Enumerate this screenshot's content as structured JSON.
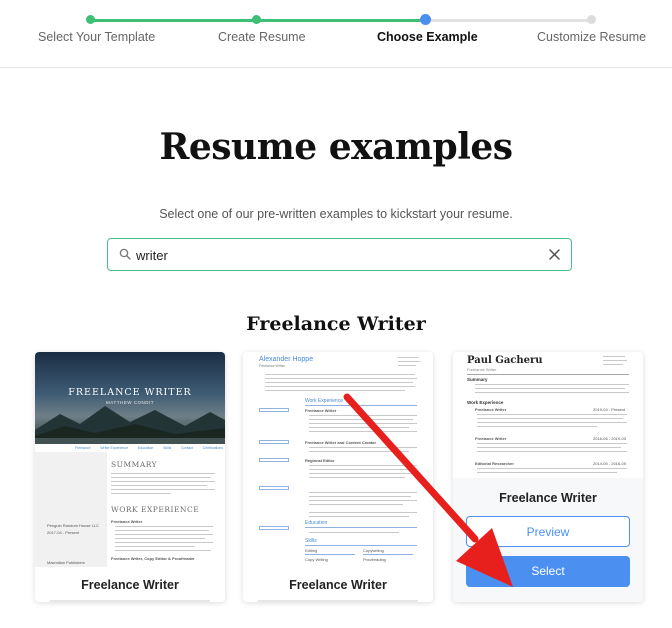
{
  "stepper": {
    "steps": [
      {
        "label": "Select Your Template",
        "state": "done"
      },
      {
        "label": "Create Resume",
        "state": "done"
      },
      {
        "label": "Choose Example",
        "state": "current"
      },
      {
        "label": "Customize Resume",
        "state": "pending"
      }
    ],
    "colors": {
      "done": "#3dbf74",
      "current": "#4b8ff0",
      "pending": "#dcdcdc"
    }
  },
  "hero": {
    "title": "Resume examples",
    "subtitle": "Select one of our pre-written examples to kickstart your resume."
  },
  "search": {
    "value": "writer",
    "icon": "search-icon",
    "clear_icon": "close-icon"
  },
  "results": {
    "section_title": "Freelance Writer",
    "cards": [
      {
        "caption": "Freelance Writer",
        "thumbnail": {
          "name": "FREELANCE WRITER",
          "subtitle": "MATTHEW CONDIT",
          "nav": [
            "Freelance",
            "Writer Experience",
            "Education",
            "Skills",
            "Contact",
            "Certifications"
          ],
          "summary_heading": "SUMMARY",
          "experience_heading": "WORK EXPERIENCE",
          "left_entries": [
            "Penguin Random House LLC",
            "2017-04 - Present",
            "Macmillan Publishers"
          ],
          "jobs": [
            "Freelance Writer",
            "Freelance Writer, Copy Editor & Proofreader"
          ]
        }
      },
      {
        "caption": "Freelance Writer",
        "thumbnail": {
          "name": "Alexander Hoppe",
          "subtitle": "Freelance Writer",
          "headings": [
            "Work Experience",
            "Education",
            "Skills"
          ],
          "jobs": [
            "Freelance Writer",
            "Freelance Writer and Content Creator",
            "Regional Editor"
          ],
          "skills": [
            "Editing",
            "Copywriting",
            "Copy Writing",
            "Proofreading"
          ]
        }
      },
      {
        "caption": "Freelance Writer",
        "preview_label": "Preview",
        "select_label": "Select",
        "thumbnail": {
          "name": "Paul Gacheru",
          "subtitle": "Freelance Writer",
          "headings": [
            "Summary",
            "Work Experience"
          ],
          "jobs": [
            "Freelance Writer",
            "Freelance Writer",
            "Editorial Researcher"
          ],
          "dates": [
            "2019-04 - Present",
            "2016-06 - 2019-03",
            "2014-05 - 2016-05"
          ]
        }
      }
    ]
  }
}
